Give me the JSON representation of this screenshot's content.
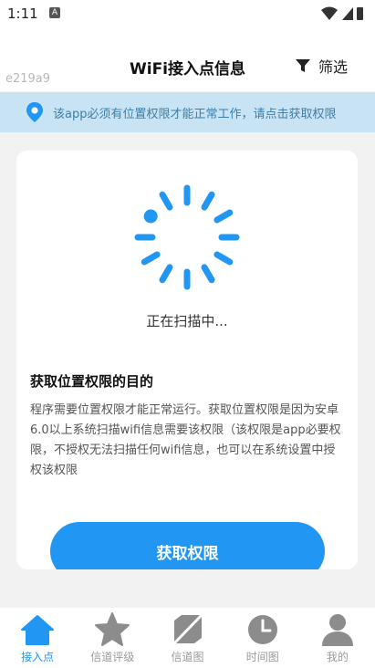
{
  "status_bar": {
    "time": "1:11",
    "notif_letter": "A"
  },
  "app_bar": {
    "subtitle": "e219a9",
    "title": "WiFi接入点信息",
    "filter_label": "筛选"
  },
  "permission_banner": {
    "text": "该app必须有位置权限才能正常工作，请点击获取权限"
  },
  "scan": {
    "status": "正在扫描中..."
  },
  "purpose": {
    "title": "获取位置权限的目的",
    "body": "程序需要位置权限才能正常运行。获取位置权限是因为安卓6.0以上系统扫描wifi信息需要该权限（该权限是app必要权限，不授权无法扫描任何wifi信息，也可以在系统设置中授权该权限"
  },
  "action_button": {
    "label": "获取权限"
  },
  "bottom_nav": [
    {
      "label": "接入点",
      "icon": "home-icon",
      "active": true
    },
    {
      "label": "信道评级",
      "icon": "star-icon",
      "active": false
    },
    {
      "label": "信道图",
      "icon": "channel-chart-icon",
      "active": false
    },
    {
      "label": "时间图",
      "icon": "clock-icon",
      "active": false
    },
    {
      "label": "我的",
      "icon": "person-icon",
      "active": false
    }
  ],
  "colors": {
    "accent": "#2196f3",
    "banner_bg": "#c8e3f3",
    "banner_text": "#3e7fa7",
    "inactive_icon": "#8c8c8c"
  }
}
